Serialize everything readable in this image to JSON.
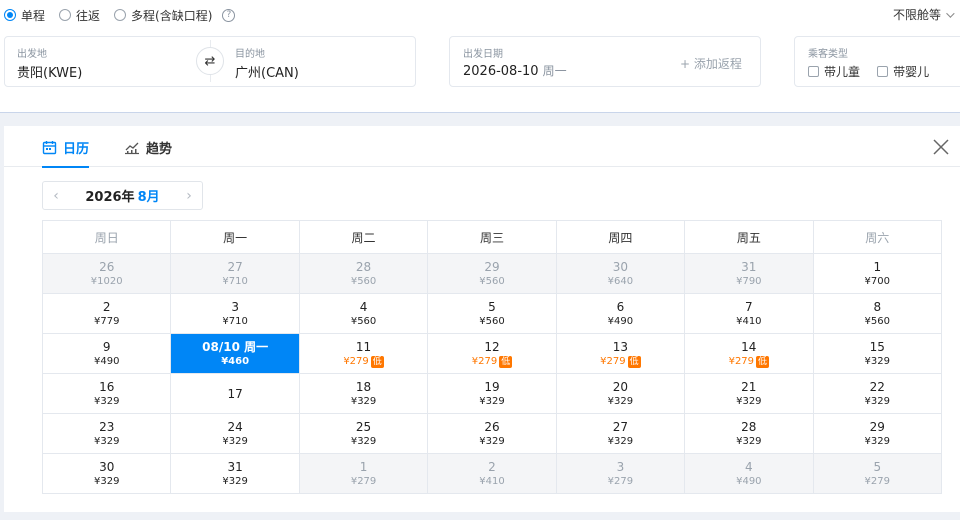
{
  "trip_types": [
    {
      "label": "单程",
      "selected": true
    },
    {
      "label": "往返",
      "selected": false
    },
    {
      "label": "多程(含缺口程)",
      "selected": false
    }
  ],
  "help_icon_glyph": "?",
  "cabin_class": "不限舱等",
  "route": {
    "from_label": "出发地",
    "from_value": "贵阳(KWE)",
    "to_label": "目的地",
    "to_value": "广州(CAN)",
    "swap_icon": "⇄"
  },
  "date": {
    "label": "出发日期",
    "value": "2026-08-10",
    "weekday": "周一",
    "add_return": "+ 添加返程"
  },
  "passenger": {
    "label": "乘客类型",
    "options": [
      "带儿童",
      "带婴儿"
    ]
  },
  "tabs": {
    "calendar": "日历",
    "trend": "趋势"
  },
  "month_nav": {
    "year": "2026年",
    "month": "8月",
    "prev": "‹",
    "next": "›"
  },
  "weekdays": [
    "周日",
    "周一",
    "周二",
    "周三",
    "周四",
    "周五",
    "周六"
  ],
  "low_tag": "低",
  "weeks": [
    [
      {
        "day": "26",
        "price": "¥1020",
        "out": true
      },
      {
        "day": "27",
        "price": "¥710",
        "out": true
      },
      {
        "day": "28",
        "price": "¥560",
        "out": true
      },
      {
        "day": "29",
        "price": "¥560",
        "out": true
      },
      {
        "day": "30",
        "price": "¥640",
        "out": true
      },
      {
        "day": "31",
        "price": "¥790",
        "out": true
      },
      {
        "day": "1",
        "price": "¥700"
      }
    ],
    [
      {
        "day": "2",
        "price": "¥779"
      },
      {
        "day": "3",
        "price": "¥710"
      },
      {
        "day": "4",
        "price": "¥560"
      },
      {
        "day": "5",
        "price": "¥560"
      },
      {
        "day": "6",
        "price": "¥490"
      },
      {
        "day": "7",
        "price": "¥410"
      },
      {
        "day": "8",
        "price": "¥560"
      }
    ],
    [
      {
        "day": "9",
        "price": "¥490"
      },
      {
        "day": "08/10 周一",
        "price": "¥460",
        "selected": true
      },
      {
        "day": "11",
        "price": "¥279",
        "low": true
      },
      {
        "day": "12",
        "price": "¥279",
        "low": true
      },
      {
        "day": "13",
        "price": "¥279",
        "low": true
      },
      {
        "day": "14",
        "price": "¥279",
        "low": true
      },
      {
        "day": "15",
        "price": "¥329"
      }
    ],
    [
      {
        "day": "16",
        "price": "¥329"
      },
      {
        "day": "17",
        "price": ""
      },
      {
        "day": "18",
        "price": "¥329"
      },
      {
        "day": "19",
        "price": "¥329"
      },
      {
        "day": "20",
        "price": "¥329"
      },
      {
        "day": "21",
        "price": "¥329"
      },
      {
        "day": "22",
        "price": "¥329"
      }
    ],
    [
      {
        "day": "23",
        "price": "¥329"
      },
      {
        "day": "24",
        "price": "¥329"
      },
      {
        "day": "25",
        "price": "¥329"
      },
      {
        "day": "26",
        "price": "¥329"
      },
      {
        "day": "27",
        "price": "¥329"
      },
      {
        "day": "28",
        "price": "¥329"
      },
      {
        "day": "29",
        "price": "¥329"
      }
    ],
    [
      {
        "day": "30",
        "price": "¥329"
      },
      {
        "day": "31",
        "price": "¥329"
      },
      {
        "day": "1",
        "price": "¥279",
        "out": true
      },
      {
        "day": "2",
        "price": "¥410",
        "out": true
      },
      {
        "day": "3",
        "price": "¥279",
        "out": true
      },
      {
        "day": "4",
        "price": "¥490",
        "out": true
      },
      {
        "day": "5",
        "price": "¥279",
        "out": true
      }
    ]
  ],
  "colors": {
    "accent": "#0086f6",
    "low_price": "#ff7700",
    "muted": "#9aa3ad"
  }
}
